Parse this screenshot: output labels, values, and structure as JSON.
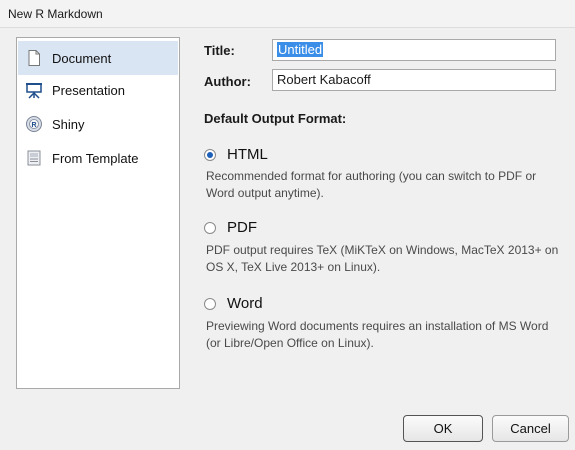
{
  "window": {
    "title": "New R Markdown"
  },
  "sidebar": {
    "items": [
      {
        "label": "Document",
        "icon": "document-icon",
        "selected": true
      },
      {
        "label": "Presentation",
        "icon": "presentation-icon",
        "selected": false
      },
      {
        "label": "Shiny",
        "icon": "shiny-icon",
        "selected": false
      },
      {
        "label": "From Template",
        "icon": "template-icon",
        "selected": false
      }
    ]
  },
  "form": {
    "title_label": "Title:",
    "title_value": "Untitled",
    "author_label": "Author:",
    "author_value": "Robert Kabacoff"
  },
  "output": {
    "heading": "Default Output Format:",
    "options": [
      {
        "label": "HTML",
        "checked": true,
        "description": "Recommended format for authoring (you can switch to PDF or Word output anytime)."
      },
      {
        "label": "PDF",
        "checked": false,
        "description": "PDF output requires TeX (MiKTeX on Windows, MacTeX 2013+ on OS X, TeX Live 2013+ on Linux)."
      },
      {
        "label": "Word",
        "checked": false,
        "description": "Previewing Word documents requires an installation of MS Word (or Libre/Open Office on Linux)."
      }
    ]
  },
  "buttons": {
    "ok": "OK",
    "cancel": "Cancel"
  },
  "colors": {
    "selection": "#d9e5f3",
    "text_highlight": "#3b8ee8",
    "radio_dot": "#1e5fb8"
  }
}
